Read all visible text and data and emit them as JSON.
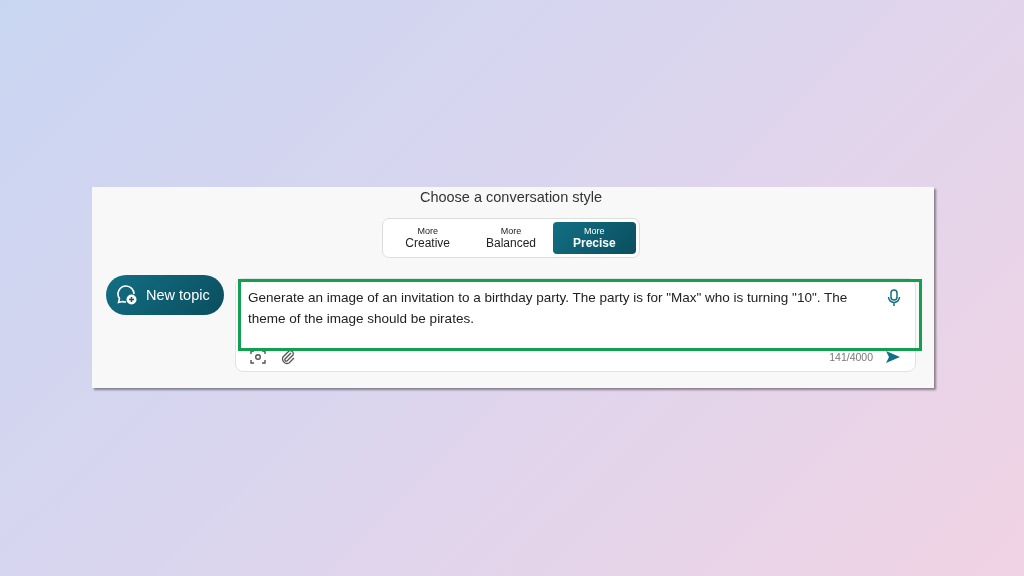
{
  "style_picker": {
    "title": "Choose a conversation style",
    "options": [
      {
        "prefix": "More",
        "label": "Creative",
        "selected": false
      },
      {
        "prefix": "More",
        "label": "Balanced",
        "selected": false
      },
      {
        "prefix": "More",
        "label": "Precise",
        "selected": true
      }
    ]
  },
  "new_topic_button": {
    "label": "New topic"
  },
  "composer": {
    "value": "Generate an image of an invitation to a birthday party. The party is for \"Max\" who is turning \"10\". The theme of the image should be pirates.",
    "counter": "141/4000",
    "highlighted": true
  }
}
